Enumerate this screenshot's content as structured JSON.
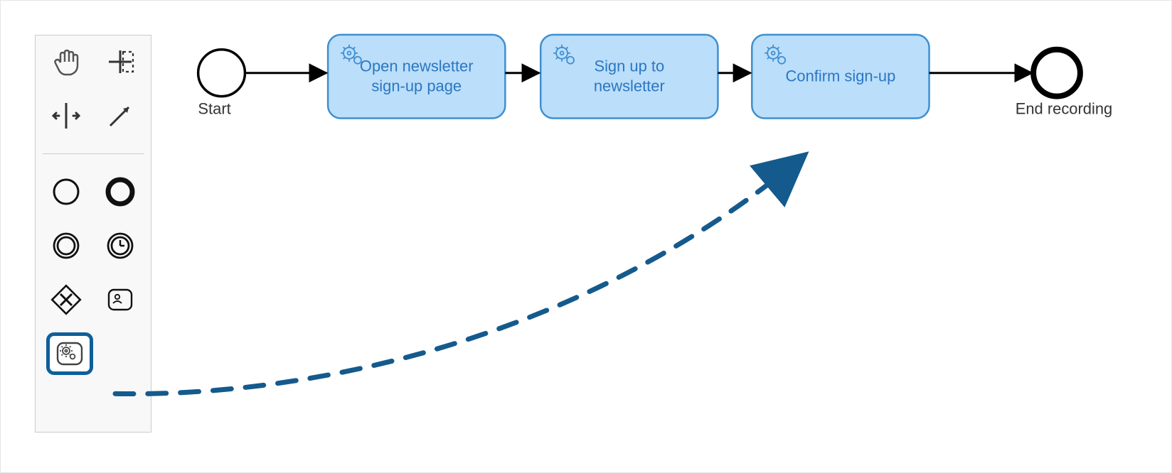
{
  "palette": {
    "tools": {
      "hand": "hand-tool",
      "lasso": "lasso-tool",
      "space": "space-tool",
      "connect": "global-connect-tool",
      "start_event": "start-event",
      "end_event": "end-event",
      "intermediate_event": "intermediate-event",
      "timer_event": "timer-event",
      "gateway": "exclusive-gateway",
      "user_task": "user-task",
      "service_task": "service-task"
    }
  },
  "flow": {
    "start_label": "Start",
    "end_label": "End recording",
    "tasks": [
      {
        "line1": "Open newsletter",
        "line2": "sign-up page"
      },
      {
        "line1": "Sign up to",
        "line2": "newsletter"
      },
      {
        "line1": "Confirm sign-up",
        "line2": ""
      }
    ]
  },
  "colors": {
    "task_fill": "#BBDEFB",
    "task_stroke": "#3E8FD0",
    "accent": "#145A8D"
  }
}
